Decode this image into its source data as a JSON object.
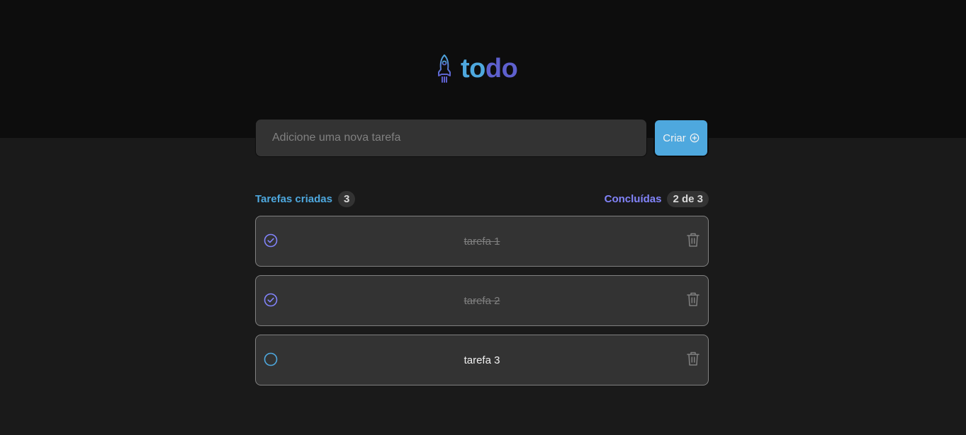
{
  "app": {
    "logo_to": "to",
    "logo_do": "do"
  },
  "new_task": {
    "placeholder": "Adicione uma nova tarefa",
    "value": "",
    "create_label": "Criar"
  },
  "counters": {
    "created_label": "Tarefas criadas",
    "created_count": "3",
    "done_label": "Concluídas",
    "done_count": "2 de 3"
  },
  "tasks": [
    {
      "text": "tarefa 1",
      "completed": true
    },
    {
      "text": "tarefa 2",
      "completed": true
    },
    {
      "text": "tarefa 3",
      "completed": false
    }
  ],
  "colors": {
    "blue": "#4ea8de",
    "purple": "#5e60ce",
    "purple_light": "#8284fa",
    "gray_100": "#f2f2f2",
    "gray_400": "#808080",
    "gray_500": "#333333",
    "gray_600": "#1a1a1a",
    "gray_700": "#0d0d0d"
  },
  "icons": {
    "logo": "rocket-icon",
    "create": "plus-circle-icon",
    "checked": "check-circle-icon",
    "unchecked": "circle-icon",
    "delete": "trash-icon"
  }
}
